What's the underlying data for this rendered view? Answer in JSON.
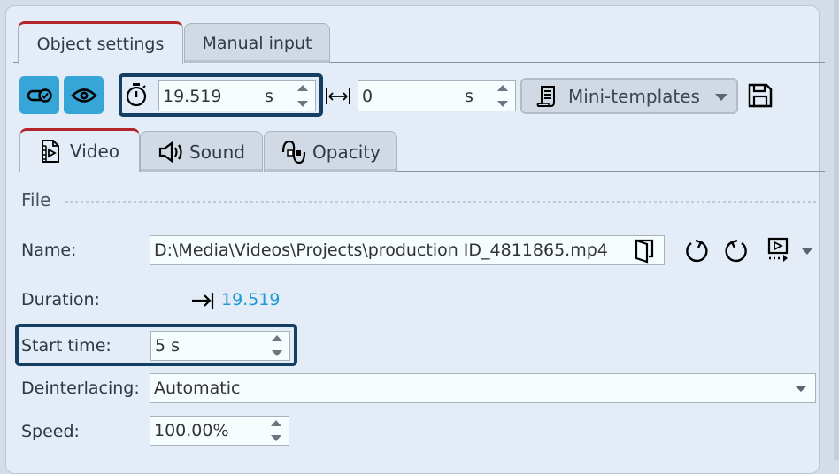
{
  "tabs_top": [
    {
      "label": "Object settings",
      "active": true
    },
    {
      "label": "Manual input",
      "active": false
    }
  ],
  "toolbar": {
    "toggle_icon": "toggle-check-icon",
    "visibility_icon": "eye-icon",
    "duration_icon": "stopwatch-icon",
    "duration_value": "19.519",
    "duration_unit": "s",
    "offset_icon": "width-arrows-icon",
    "offset_value": "0",
    "offset_unit": "s",
    "mini_templates_label": "Mini-templates",
    "mini_templates_icon": "scroll-document-icon",
    "save_icon": "floppy-disk-icon"
  },
  "tabs_sub": [
    {
      "label": "Video",
      "icon": "film-document-icon",
      "active": true
    },
    {
      "label": "Sound",
      "icon": "speaker-icon",
      "active": false
    },
    {
      "label": "Opacity",
      "icon": "opacity-curve-icon",
      "active": false
    }
  ],
  "section": {
    "title": "File"
  },
  "form": {
    "name_label": "Name:",
    "name_value": "D:\\Media\\Videos\\Projects\\production ID_4811865.mp4",
    "duration_label": "Duration:",
    "duration_value": "19.519",
    "start_time_label": "Start time:",
    "start_time_value": "5 s",
    "deinterlacing_label": "Deinterlacing:",
    "deinterlacing_value": "Automatic",
    "speed_label": "Speed:",
    "speed_value": "100.00%"
  },
  "colors": {
    "accent_blue": "#36a6d8",
    "highlight_border": "#153e63",
    "active_tab_top": "#b3272c",
    "duration_text": "#1e9ad0"
  }
}
